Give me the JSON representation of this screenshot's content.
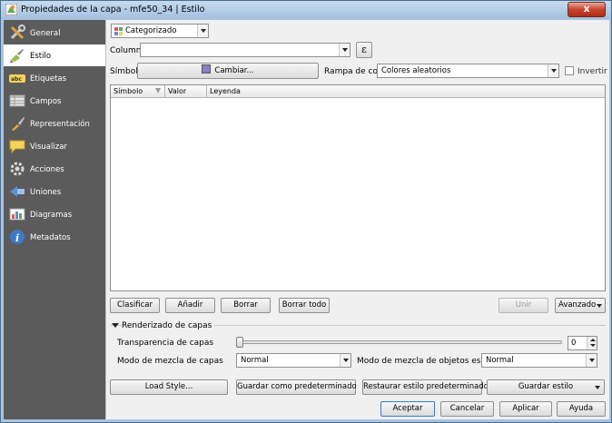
{
  "window": {
    "title": "Propiedades de la capa - mfe50_34 | Estilo",
    "close_label": "x"
  },
  "sidebar": {
    "items": [
      {
        "label": "General",
        "icon": "tools-icon"
      },
      {
        "label": "Estilo",
        "icon": "paintbrush-icon"
      },
      {
        "label": "Etiquetas",
        "icon": "abc-label-icon"
      },
      {
        "label": "Campos",
        "icon": "table-icon"
      },
      {
        "label": "Representación",
        "icon": "brush-icon"
      },
      {
        "label": "Visualizar",
        "icon": "speech-bubble-icon"
      },
      {
        "label": "Acciones",
        "icon": "gear-icon"
      },
      {
        "label": "Uniones",
        "icon": "join-icon"
      },
      {
        "label": "Diagramas",
        "icon": "diagram-icon"
      },
      {
        "label": "Metadatos",
        "icon": "info-icon"
      }
    ],
    "active_index": 1
  },
  "renderer": {
    "type_value": "Categorizado"
  },
  "column": {
    "label": "Columna",
    "value": "",
    "expr_button": "ε"
  },
  "symbol": {
    "label": "Símbolo",
    "change_button": "Cambiar...",
    "swatch_color": "#8c7fc6"
  },
  "color_ramp": {
    "label": "Rampa de color",
    "value": "Colores aleatorios",
    "invert_label": "Invertir"
  },
  "table": {
    "columns": [
      "Símbolo",
      "Valor",
      "Leyenda"
    ]
  },
  "actions": {
    "classify": "Clasificar",
    "add": "Añadir",
    "delete": "Borrar",
    "delete_all": "Borrar todo",
    "join": "Unir",
    "advanced": "Avanzado"
  },
  "layer_rendering": {
    "section_title": "Renderizado de capas",
    "transparency_label": "Transparencia de capas",
    "transparency_value": "0",
    "blend_label": "Modo de mezcla de capas",
    "blend_value": "Normal",
    "feature_blend_label": "Modo de mezcla de objetos espaciales",
    "feature_blend_value": "Normal"
  },
  "style_buttons": {
    "load": "Load Style...",
    "save_default": "Guardar como predeterminado",
    "restore_default": "Restaurar estilo predeterminado",
    "save_style": "Guardar estilo"
  },
  "dialog_buttons": {
    "ok": "Aceptar",
    "cancel": "Cancelar",
    "apply": "Aplicar",
    "help": "Ayuda"
  }
}
